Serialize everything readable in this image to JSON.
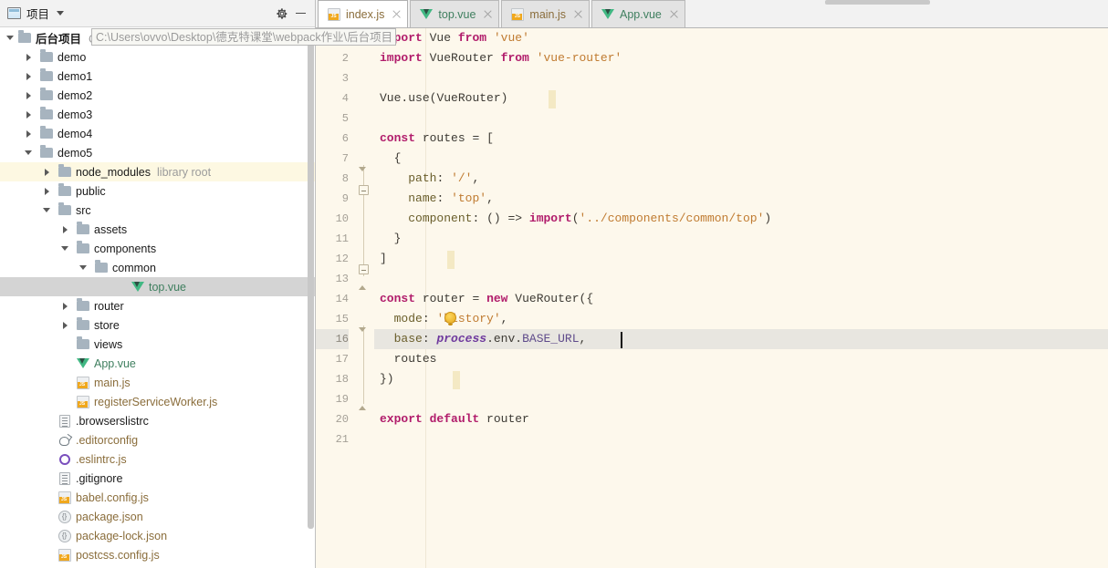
{
  "panel": {
    "title": "项目",
    "icons": {
      "settings": "gear-icon",
      "minimize": "minimize-icon",
      "dropdown": "chevron-down-icon"
    }
  },
  "project": {
    "root_name": "后台项目",
    "root_path": "C:\\Users\\ovvo\\Desktop\\德克特课堂\\webpack作业\\后台项目",
    "tree": [
      {
        "label": "demo",
        "indent": 1,
        "state": "closed",
        "icon": "folder-icon",
        "kind": "folder"
      },
      {
        "label": "demo1",
        "indent": 1,
        "state": "closed",
        "icon": "folder-icon",
        "kind": "folder"
      },
      {
        "label": "demo2",
        "indent": 1,
        "state": "closed",
        "icon": "folder-icon",
        "kind": "folder"
      },
      {
        "label": "demo3",
        "indent": 1,
        "state": "closed",
        "icon": "folder-icon",
        "kind": "folder"
      },
      {
        "label": "demo4",
        "indent": 1,
        "state": "closed",
        "icon": "folder-icon",
        "kind": "folder"
      },
      {
        "label": "demo5",
        "indent": 1,
        "state": "open",
        "icon": "folder-icon",
        "kind": "folder"
      },
      {
        "label": "node_modules",
        "sub": "library root",
        "indent": 2,
        "state": "closed",
        "icon": "folder-icon",
        "kind": "folder",
        "row_style": "highlight-yellow"
      },
      {
        "label": "public",
        "indent": 2,
        "state": "closed",
        "icon": "folder-icon",
        "kind": "folder"
      },
      {
        "label": "src",
        "indent": 2,
        "state": "open",
        "icon": "folder-icon",
        "kind": "folder"
      },
      {
        "label": "assets",
        "indent": 3,
        "state": "closed",
        "icon": "folder-icon",
        "kind": "folder"
      },
      {
        "label": "components",
        "indent": 3,
        "state": "open",
        "icon": "folder-icon",
        "kind": "folder"
      },
      {
        "label": "common",
        "indent": 4,
        "state": "open",
        "icon": "folder-icon",
        "kind": "folder"
      },
      {
        "label": "top.vue",
        "indent": 6,
        "state": "none",
        "icon": "vue-icon",
        "kind": "vue",
        "row_style": "selected"
      },
      {
        "label": "router",
        "indent": 3,
        "state": "closed",
        "icon": "folder-icon",
        "kind": "folder"
      },
      {
        "label": "store",
        "indent": 3,
        "state": "closed",
        "icon": "folder-icon",
        "kind": "folder"
      },
      {
        "label": "views",
        "indent": 3,
        "state": "none",
        "icon": "folder-icon",
        "kind": "folder"
      },
      {
        "label": "App.vue",
        "indent": 3,
        "state": "none",
        "icon": "vue-icon",
        "kind": "vue"
      },
      {
        "label": "main.js",
        "indent": 3,
        "state": "none",
        "icon": "js-icon",
        "kind": "js"
      },
      {
        "label": "registerServiceWorker.js",
        "indent": 3,
        "state": "none",
        "icon": "js-icon",
        "kind": "js"
      },
      {
        "label": ".browserslistrc",
        "indent": 2,
        "state": "none",
        "icon": "text-file-icon",
        "kind": "txt"
      },
      {
        "label": ".editorconfig",
        "indent": 2,
        "state": "none",
        "icon": "editorconfig-icon",
        "kind": "cfg"
      },
      {
        "label": ".eslintrc.js",
        "indent": 2,
        "state": "none",
        "icon": "eslint-icon",
        "kind": "eslint"
      },
      {
        "label": ".gitignore",
        "indent": 2,
        "state": "none",
        "icon": "text-file-icon",
        "kind": "txt"
      },
      {
        "label": "babel.config.js",
        "indent": 2,
        "state": "none",
        "icon": "js-icon",
        "kind": "js"
      },
      {
        "label": "package.json",
        "indent": 2,
        "state": "none",
        "icon": "json-icon",
        "kind": "json"
      },
      {
        "label": "package-lock.json",
        "indent": 2,
        "state": "none",
        "icon": "json-icon",
        "kind": "json"
      },
      {
        "label": "postcss.config.js",
        "indent": 2,
        "state": "none",
        "icon": "js-icon",
        "kind": "js"
      }
    ]
  },
  "tabs": [
    {
      "label": "index.js",
      "icon": "js-icon",
      "kind": "js",
      "active": true
    },
    {
      "label": "top.vue",
      "icon": "vue-icon",
      "kind": "vue",
      "active": false
    },
    {
      "label": "main.js",
      "icon": "js-icon",
      "kind": "js",
      "active": false
    },
    {
      "label": "App.vue",
      "icon": "vue-icon",
      "kind": "vue",
      "active": false
    }
  ],
  "editor": {
    "current_line": 16,
    "line_count": 21,
    "caret_column_text": "base: process.env.BASE_URL,",
    "bulb_icon": "intention-bulb-icon",
    "lines": [
      {
        "n": 1,
        "text": "import Vue from 'vue'"
      },
      {
        "n": 2,
        "text": "import VueRouter from 'vue-router'"
      },
      {
        "n": 3,
        "text": ""
      },
      {
        "n": 4,
        "text": "Vue.use(VueRouter)"
      },
      {
        "n": 5,
        "text": ""
      },
      {
        "n": 6,
        "text": "const routes = ["
      },
      {
        "n": 7,
        "text": "  {"
      },
      {
        "n": 8,
        "text": "    path: '/',"
      },
      {
        "n": 9,
        "text": "    name: 'top',"
      },
      {
        "n": 10,
        "text": "    component: () => import('../components/common/top')"
      },
      {
        "n": 11,
        "text": "  }"
      },
      {
        "n": 12,
        "text": "]"
      },
      {
        "n": 13,
        "text": ""
      },
      {
        "n": 14,
        "text": "const router = new VueRouter({"
      },
      {
        "n": 15,
        "text": "  mode: 'history',"
      },
      {
        "n": 16,
        "text": "  base: process.env.BASE_URL,"
      },
      {
        "n": 17,
        "text": "  routes"
      },
      {
        "n": 18,
        "text": "})"
      },
      {
        "n": 19,
        "text": ""
      },
      {
        "n": 20,
        "text": "export default router"
      },
      {
        "n": 21,
        "text": ""
      }
    ]
  },
  "colors": {
    "editor_bg": "#fdf8ec",
    "current_line_bg": "#e8e6e0",
    "keyword": "#b11c6b",
    "string": "#c07b31",
    "field": "#6a5e2b",
    "vue_green": "#41b883",
    "js_orange": "#f0a81e",
    "selection_gray": "#d4d4d4",
    "library_root_yellow": "#fdf8e2"
  }
}
